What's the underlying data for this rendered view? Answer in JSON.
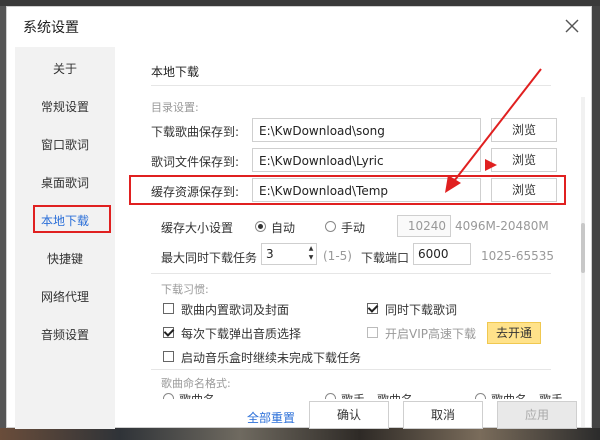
{
  "window": {
    "title": "系统设置"
  },
  "sidebar": {
    "items": [
      {
        "label": "关于"
      },
      {
        "label": "常规设置"
      },
      {
        "label": "窗口歌词"
      },
      {
        "label": "桌面歌词"
      },
      {
        "label": "本地下载"
      },
      {
        "label": "快捷键"
      },
      {
        "label": "网络代理"
      },
      {
        "label": "音频设置"
      }
    ],
    "active": "本地下载"
  },
  "section": {
    "title": "本地下载"
  },
  "directory": {
    "group_label": "目录设置:",
    "song": {
      "label": "下载歌曲保存到:",
      "value": "E:\\KwDownload\\song",
      "button": "浏览"
    },
    "lyric": {
      "label": "歌词文件保存到:",
      "value": "E:\\KwDownload\\Lyric",
      "button": "浏览"
    },
    "cache": {
      "label": "缓存资源保存到:",
      "value": "E:\\KwDownload\\Temp",
      "button": "浏览"
    }
  },
  "cache_size": {
    "label": "缓存大小设置",
    "auto": "自动",
    "manual": "手动",
    "selected": "自动",
    "value": "10240",
    "range": "4096M-20480M"
  },
  "download": {
    "max_tasks_label": "最大同时下载任务",
    "max_tasks_value": "3",
    "max_tasks_range": "(1-5)",
    "port_label": "下载端口",
    "port_value": "6000",
    "port_range": "1025-65535"
  },
  "habits": {
    "group_label": "下载习惯:",
    "embed_lyrics": {
      "label": "歌曲内置歌词及封面",
      "checked": false
    },
    "download_lyrics": {
      "label": "同时下载歌词",
      "checked": true
    },
    "quality_popup": {
      "label": "每次下载弹出音质选择",
      "checked": true
    },
    "vip_fast": {
      "label": "开启VIP高速下载",
      "checked": false,
      "enabled": false,
      "button": "去开通"
    },
    "resume_on_start": {
      "label": "启动音乐盒时继续未完成下载任务",
      "checked": false
    }
  },
  "naming": {
    "group_label": "歌曲命名格式:",
    "option1": "歌曲名",
    "option2": "歌手 - 歌曲名",
    "option3": "歌曲名 - 歌手"
  },
  "footer": {
    "reset": "全部重置",
    "ok": "确认",
    "cancel": "取消",
    "apply": "应用"
  },
  "colors": {
    "highlight": "#e02020",
    "link": "#2b6fd8",
    "promo": "#ffe28a"
  }
}
